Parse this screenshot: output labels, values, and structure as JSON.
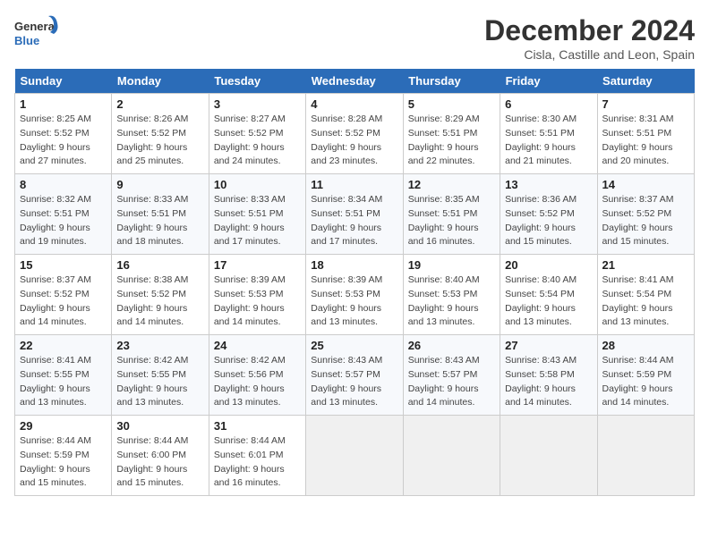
{
  "logo": {
    "text_general": "General",
    "text_blue": "Blue"
  },
  "header": {
    "month": "December 2024",
    "location": "Cisla, Castille and Leon, Spain"
  },
  "weekdays": [
    "Sunday",
    "Monday",
    "Tuesday",
    "Wednesday",
    "Thursday",
    "Friday",
    "Saturday"
  ],
  "weeks": [
    [
      {
        "day": "1",
        "sunrise": "8:25 AM",
        "sunset": "5:52 PM",
        "daylight": "9 hours and 27 minutes."
      },
      {
        "day": "2",
        "sunrise": "8:26 AM",
        "sunset": "5:52 PM",
        "daylight": "9 hours and 25 minutes."
      },
      {
        "day": "3",
        "sunrise": "8:27 AM",
        "sunset": "5:52 PM",
        "daylight": "9 hours and 24 minutes."
      },
      {
        "day": "4",
        "sunrise": "8:28 AM",
        "sunset": "5:52 PM",
        "daylight": "9 hours and 23 minutes."
      },
      {
        "day": "5",
        "sunrise": "8:29 AM",
        "sunset": "5:51 PM",
        "daylight": "9 hours and 22 minutes."
      },
      {
        "day": "6",
        "sunrise": "8:30 AM",
        "sunset": "5:51 PM",
        "daylight": "9 hours and 21 minutes."
      },
      {
        "day": "7",
        "sunrise": "8:31 AM",
        "sunset": "5:51 PM",
        "daylight": "9 hours and 20 minutes."
      }
    ],
    [
      {
        "day": "8",
        "sunrise": "8:32 AM",
        "sunset": "5:51 PM",
        "daylight": "9 hours and 19 minutes."
      },
      {
        "day": "9",
        "sunrise": "8:33 AM",
        "sunset": "5:51 PM",
        "daylight": "9 hours and 18 minutes."
      },
      {
        "day": "10",
        "sunrise": "8:33 AM",
        "sunset": "5:51 PM",
        "daylight": "9 hours and 17 minutes."
      },
      {
        "day": "11",
        "sunrise": "8:34 AM",
        "sunset": "5:51 PM",
        "daylight": "9 hours and 17 minutes."
      },
      {
        "day": "12",
        "sunrise": "8:35 AM",
        "sunset": "5:51 PM",
        "daylight": "9 hours and 16 minutes."
      },
      {
        "day": "13",
        "sunrise": "8:36 AM",
        "sunset": "5:52 PM",
        "daylight": "9 hours and 15 minutes."
      },
      {
        "day": "14",
        "sunrise": "8:37 AM",
        "sunset": "5:52 PM",
        "daylight": "9 hours and 15 minutes."
      }
    ],
    [
      {
        "day": "15",
        "sunrise": "8:37 AM",
        "sunset": "5:52 PM",
        "daylight": "9 hours and 14 minutes."
      },
      {
        "day": "16",
        "sunrise": "8:38 AM",
        "sunset": "5:52 PM",
        "daylight": "9 hours and 14 minutes."
      },
      {
        "day": "17",
        "sunrise": "8:39 AM",
        "sunset": "5:53 PM",
        "daylight": "9 hours and 14 minutes."
      },
      {
        "day": "18",
        "sunrise": "8:39 AM",
        "sunset": "5:53 PM",
        "daylight": "9 hours and 13 minutes."
      },
      {
        "day": "19",
        "sunrise": "8:40 AM",
        "sunset": "5:53 PM",
        "daylight": "9 hours and 13 minutes."
      },
      {
        "day": "20",
        "sunrise": "8:40 AM",
        "sunset": "5:54 PM",
        "daylight": "9 hours and 13 minutes."
      },
      {
        "day": "21",
        "sunrise": "8:41 AM",
        "sunset": "5:54 PM",
        "daylight": "9 hours and 13 minutes."
      }
    ],
    [
      {
        "day": "22",
        "sunrise": "8:41 AM",
        "sunset": "5:55 PM",
        "daylight": "9 hours and 13 minutes."
      },
      {
        "day": "23",
        "sunrise": "8:42 AM",
        "sunset": "5:55 PM",
        "daylight": "9 hours and 13 minutes."
      },
      {
        "day": "24",
        "sunrise": "8:42 AM",
        "sunset": "5:56 PM",
        "daylight": "9 hours and 13 minutes."
      },
      {
        "day": "25",
        "sunrise": "8:43 AM",
        "sunset": "5:57 PM",
        "daylight": "9 hours and 13 minutes."
      },
      {
        "day": "26",
        "sunrise": "8:43 AM",
        "sunset": "5:57 PM",
        "daylight": "9 hours and 14 minutes."
      },
      {
        "day": "27",
        "sunrise": "8:43 AM",
        "sunset": "5:58 PM",
        "daylight": "9 hours and 14 minutes."
      },
      {
        "day": "28",
        "sunrise": "8:44 AM",
        "sunset": "5:59 PM",
        "daylight": "9 hours and 14 minutes."
      }
    ],
    [
      {
        "day": "29",
        "sunrise": "8:44 AM",
        "sunset": "5:59 PM",
        "daylight": "9 hours and 15 minutes."
      },
      {
        "day": "30",
        "sunrise": "8:44 AM",
        "sunset": "6:00 PM",
        "daylight": "9 hours and 15 minutes."
      },
      {
        "day": "31",
        "sunrise": "8:44 AM",
        "sunset": "6:01 PM",
        "daylight": "9 hours and 16 minutes."
      },
      null,
      null,
      null,
      null
    ]
  ],
  "labels": {
    "sunrise": "Sunrise:",
    "sunset": "Sunset:",
    "daylight": "Daylight:"
  }
}
